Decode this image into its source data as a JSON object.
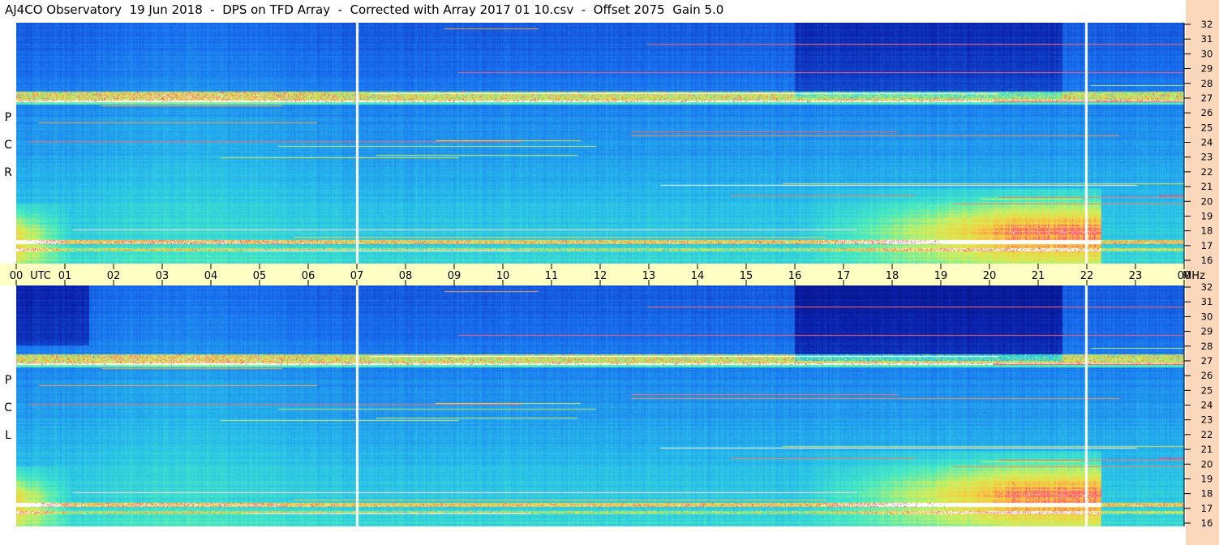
{
  "title": "AJ4CO Observatory  19 Jun 2018  -  DPS on TFD Array  -  Corrected with Array 2017 01 10.csv  -  Offset 2075  Gain 5.0",
  "panels": [
    {
      "label": [
        "R",
        "C",
        "P"
      ]
    },
    {
      "label": [
        "L",
        "C",
        "P"
      ]
    }
  ],
  "time_axis": {
    "ticks": [
      "00",
      "01",
      "02",
      "03",
      "04",
      "05",
      "06",
      "07",
      "08",
      "09",
      "10",
      "11",
      "12",
      "13",
      "14",
      "15",
      "16",
      "17",
      "18",
      "19",
      "20",
      "21",
      "22",
      "23",
      "00"
    ],
    "utc_label": "UTC",
    "unit": "MHz"
  },
  "freq_axis": {
    "ticks": [
      "32",
      "31",
      "30",
      "29",
      "28",
      "27",
      "26",
      "25",
      "24",
      "23",
      "22",
      "21",
      "20",
      "19",
      "18",
      "17",
      "16"
    ]
  },
  "colors": {
    "background_low": "#0a1a8a",
    "background_mid": "#1f6fe8",
    "background_high": "#3fe0d0",
    "hot": "#f4e94a",
    "hottest": "#ff3c78",
    "time_axis_bg": "#ffffc4",
    "freq_axis_bg": "#fbd7bc",
    "gap_line": "#ffffff"
  },
  "chart_data": {
    "type": "heatmap",
    "title": "AJ4CO Observatory  19 Jun 2018  -  DPS on TFD Array  -  Corrected with Array 2017 01 10.csv  -  Offset 2075  Gain 5.0",
    "xlabel": "UTC",
    "ylabel": "MHz",
    "xlim": [
      0,
      24
    ],
    "ylim": [
      16,
      32
    ],
    "panels": [
      "RCP",
      "LCP"
    ],
    "data_gaps_utc": [
      7.0,
      22.0
    ],
    "interference_bands_mhz": [
      27,
      26.8,
      17.5
    ],
    "storm_window_utc": [
      16,
      22
    ],
    "storm_band_mhz": [
      17,
      20
    ]
  }
}
